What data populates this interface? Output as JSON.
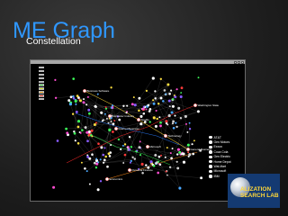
{
  "slide": {
    "title": "ME Graph",
    "subtitle": "Constellation"
  },
  "window": {
    "title_text": "",
    "toolbar_colors": [
      "#c8c8c8",
      "#d92c9a",
      "#c04adc",
      "#8a3cc8",
      "#2bb0d8",
      "#2fbf3a",
      "#c8d826",
      "#e0a020",
      "#d83020",
      "#f0e040"
    ]
  },
  "graph_labels": [
    "Washington State",
    "Computer Industry",
    "Internet Business",
    "Seattle",
    "Technology",
    "Business Software",
    "Microsoft",
    "Economics",
    "General Business",
    "Personal Finance"
  ],
  "legend": [
    "AT&T",
    "Gen Motors",
    "Exxon",
    "Coca Cola",
    "Gen Electric",
    "Home Depot",
    "Wal-Mart",
    "Microsoft",
    "IBM"
  ],
  "badge": {
    "line1": "ALIZATION",
    "line2": "SEARCH LAB"
  },
  "colors": {
    "title": "#2f97ff",
    "edge_red": "#ff2a2a",
    "edge_blue": "#2a7cff",
    "edge_yellow": "#ffd83a",
    "edge_orange": "#ff8c1a",
    "edge_green": "#2fd84a",
    "badge_bg": "#143a72",
    "badge_text": "#ffd83a"
  }
}
